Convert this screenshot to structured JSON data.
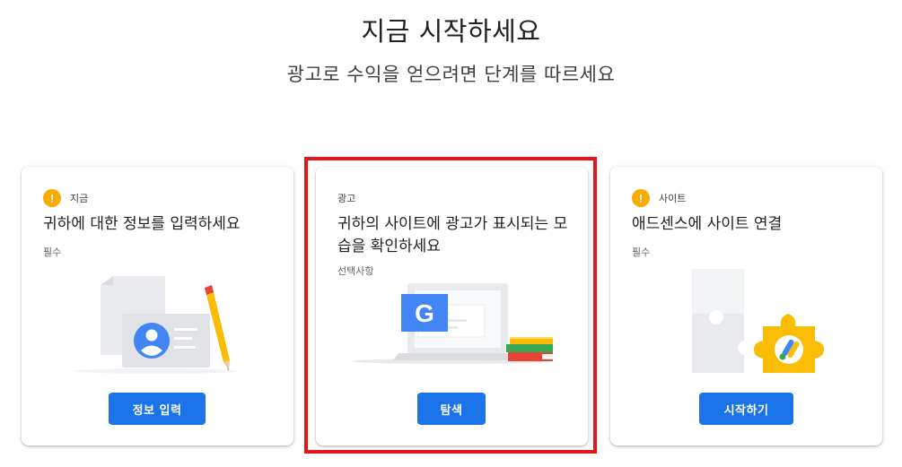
{
  "header": {
    "title": "지금 시작하세요",
    "subtitle": "광고로 수익을 얻으려면 단계를 따르세요"
  },
  "cards": [
    {
      "status": "지금",
      "title": "귀하에 대한 정보를 입력하세요",
      "note": "필수",
      "button": "정보 입력",
      "icon": "warning-icon"
    },
    {
      "status": "광고",
      "title": "귀하의 사이트에 광고가 표시되는 모습을 확인하세요",
      "note": "선택사항",
      "button": "탐색",
      "logo_letter": "G"
    },
    {
      "status": "사이트",
      "title": "애드센스에 사이트 연결",
      "note": "필수",
      "button": "시작하기",
      "icon": "warning-icon"
    }
  ],
  "colors": {
    "primary": "#1a73e8",
    "warning": "#f9ab00",
    "highlight": "#e6141b",
    "yellow": "#fbbc04",
    "google_blue": "#4285f4",
    "google_red": "#ea4335",
    "google_green": "#34a853"
  }
}
